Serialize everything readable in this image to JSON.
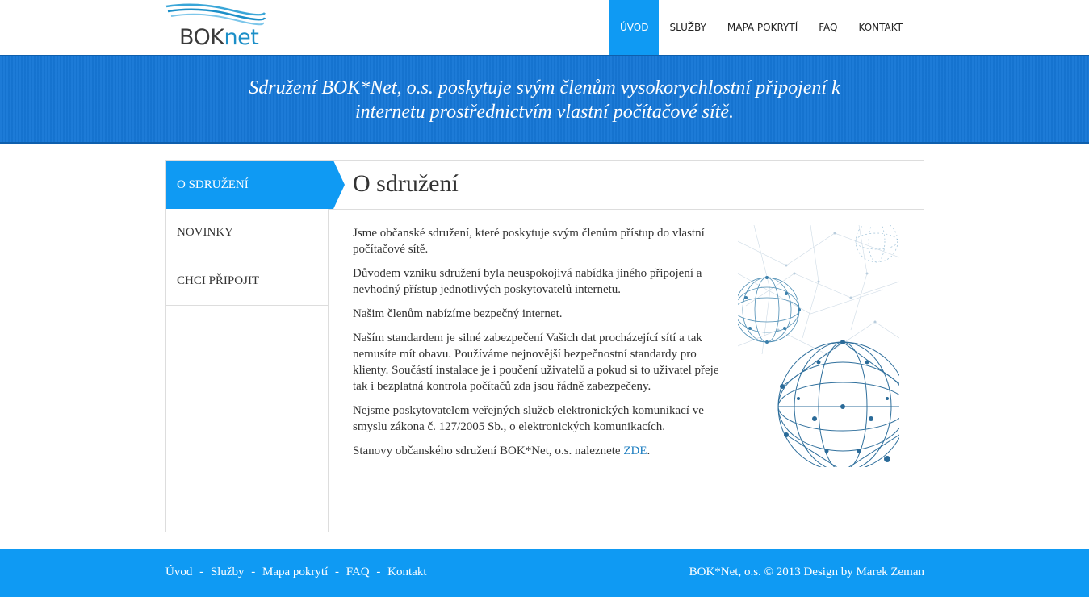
{
  "header": {
    "logo": {
      "text_bok": "BOK",
      "text_net": "net"
    },
    "nav": [
      {
        "label": "ÚVOD",
        "active": true
      },
      {
        "label": "SLUŽBY",
        "active": false
      },
      {
        "label": "MAPA POKRYTÍ",
        "active": false
      },
      {
        "label": "FAQ",
        "active": false
      },
      {
        "label": "KONTAKT",
        "active": false
      }
    ]
  },
  "banner": {
    "line1": "Sdružení BOK*Net, o.s. poskytuje svým členům vysokorychlostní připojení k",
    "line2": "internetu prostřednictvím vlastní počítačové sítě."
  },
  "sidebar": {
    "items": [
      {
        "label": "O SDRUŽENÍ",
        "active": true
      },
      {
        "label": "NOVINKY",
        "active": false
      },
      {
        "label": "CHCI PŘIPOJIT",
        "active": false
      }
    ]
  },
  "main": {
    "title": "O sdružení",
    "paragraphs": [
      "Jsme občanské sdružení, které poskytuje svým členům přístup do vlastní počítačové sítě.",
      "Důvodem vzniku sdružení byla neuspokojivá nabídka jiného připojení a nevhodný přístup jednotlivých poskytovatelů internetu.",
      "Našim členům nabízíme bezpečný internet.",
      "Naším standardem je silné zabezpečení Vašich dat procházející sítí a tak nemusíte mít obavu. Používáme nejnovější bezpečnostní standardy pro klienty. Součástí instalace je i poučení uživatelů a pokud si to uživatel přeje tak i bezplatná kontrola počítačů zda jsou řádně zabezpečeny.",
      "Nejsme poskytovatelem veřejných služeb elektronických komunikací ve smyslu zákona č. 127/2005 Sb., o elektronických komunikacích."
    ],
    "last_paragraph_prefix": "Stanovy občanského sdružení BOK*Net, o.s. naleznete ",
    "last_paragraph_link": "ZDE",
    "last_paragraph_suffix": "."
  },
  "footer": {
    "links": [
      "Úvod",
      "Služby",
      "Mapa pokrytí",
      "FAQ",
      "Kontakt"
    ],
    "separator": "-",
    "copyright": "BOK*Net, o.s. © 2013 Design by Marek Zeman"
  },
  "colors": {
    "accent": "#0f9af3",
    "banner": "#1677d6",
    "link": "#1c7dc0"
  }
}
